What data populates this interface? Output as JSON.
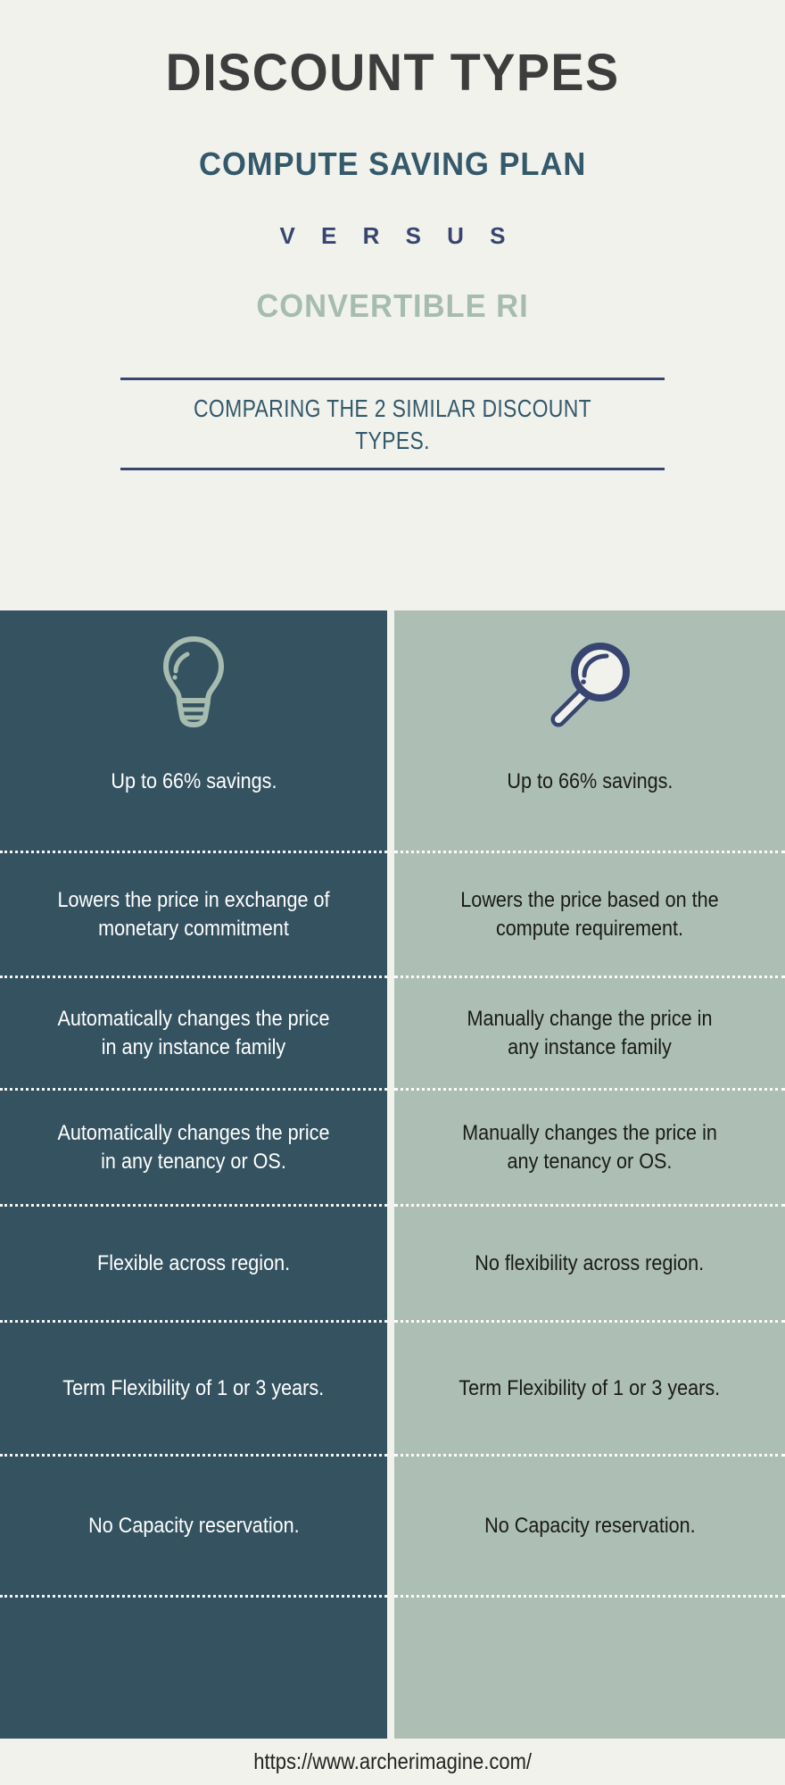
{
  "header": {
    "title": "DISCOUNT TYPES",
    "subtitle_a": "COMPUTE SAVING PLAN",
    "versus": "V E R S U S",
    "subtitle_b": "CONVERTIBLE RI",
    "description_line1": "COMPARING THE 2 SIMILAR DISCOUNT",
    "description_line2": "TYPES."
  },
  "columns": {
    "left": {
      "name": "compute-saving-plan",
      "icon": "lightbulb-icon",
      "background": "#345260",
      "text_color": "#ffffff",
      "rows": [
        "Up to 66% savings.",
        "Lowers the price in exchange of monetary commitment",
        "Automatically changes the price in any instance family",
        "Automatically changes the price in any tenancy or OS.",
        "Flexible across region.",
        "Term Flexibility of 1 or 3 years.",
        "No Capacity reservation."
      ]
    },
    "right": {
      "name": "convertible-ri",
      "icon": "magnifier-icon",
      "background": "#adbfb4",
      "text_color": "#1a1a1a",
      "rows": [
        "Up to 66% savings.",
        "Lowers the price based on the compute requirement.",
        "Manually change the price in any instance family",
        "Manually changes the price in any tenancy or OS.",
        "No flexibility across region.",
        "Term Flexibility of 1 or 3 years.",
        "No Capacity reservation."
      ]
    }
  },
  "footer": {
    "url": "https://www.archerimagine.com/"
  },
  "colors": {
    "page_background": "#f2f2ec",
    "title": "#3d3d3d",
    "teal": "#33596b",
    "navy": "#374570",
    "sage": "#a7bcb1",
    "dark_panel": "#345260",
    "sage_panel": "#adbfb4"
  }
}
